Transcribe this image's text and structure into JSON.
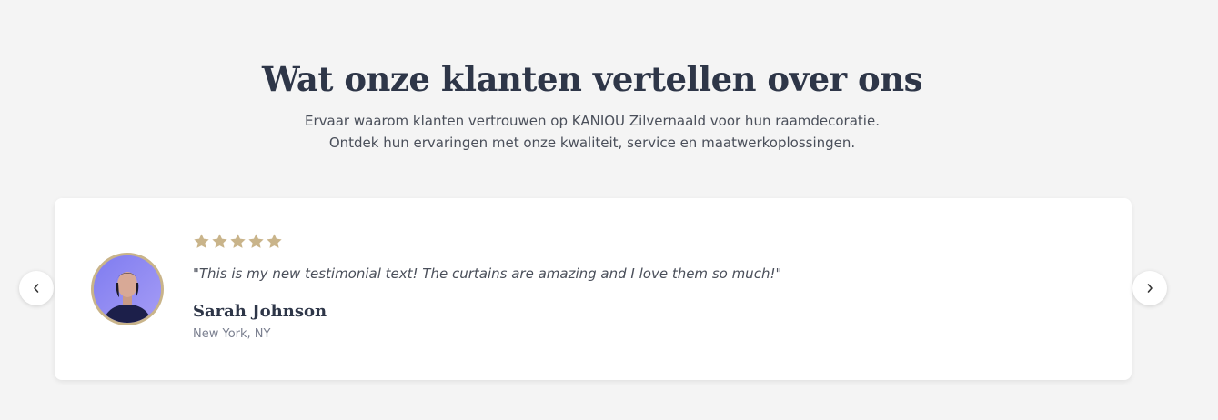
{
  "section": {
    "heading": "Wat onze klanten vertellen over ons",
    "subtitle_line1": "Ervaar waarom klanten vertrouwen op KANIOU Zilvernaald voor hun raamdecoratie.",
    "subtitle_line2": "Ontdek hun ervaringen met onze kwaliteit, service en maatwerkoplossingen."
  },
  "testimonial": {
    "rating": 5,
    "rating_max": 5,
    "quote": "\"This is my new testimonial text! The curtains are amazing and I love them so much!\"",
    "name": "Sarah Johnson",
    "location": "New York, NY"
  },
  "carousel": {
    "prev_icon": "chevron-left-icon",
    "next_icon": "chevron-right-icon"
  },
  "colors": {
    "background": "#f4f4f4",
    "heading": "#2e3648",
    "star": "#c9b48a",
    "avatar_ring": "#c9b48a"
  }
}
